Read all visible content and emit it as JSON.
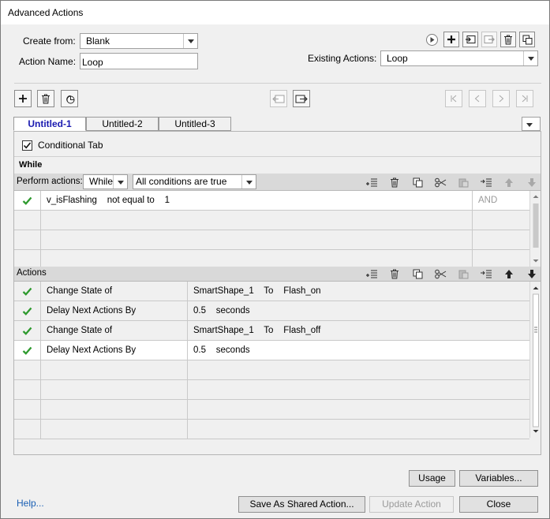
{
  "window": {
    "title": "Advanced Actions"
  },
  "form": {
    "create_from_label": "Create from:",
    "create_from_value": "Blank",
    "action_name_label": "Action Name:",
    "action_name_value": "Loop",
    "existing_actions_label": "Existing Actions:",
    "existing_actions_value": "Loop"
  },
  "tabs": [
    {
      "label": "Untitled-1",
      "active": true
    },
    {
      "label": "Untitled-2",
      "active": false
    },
    {
      "label": "Untitled-3",
      "active": false
    }
  ],
  "conditional": {
    "label": "Conditional Tab",
    "checked": true
  },
  "section_while": "While",
  "perform": {
    "label": "Perform actions:",
    "mode_value": "While",
    "conditions_value": "All conditions are true"
  },
  "conditions": [
    {
      "variable": "v_isFlashing",
      "operator": "not equal to",
      "value": "1",
      "logic": "AND"
    }
  ],
  "actions_label": "Actions",
  "actions": [
    {
      "action": "Change State of",
      "target": "SmartShape_1",
      "mid": "To",
      "param": "Flash_on"
    },
    {
      "action": "Delay Next Actions By",
      "target": "0.5",
      "mid": "seconds",
      "param": ""
    },
    {
      "action": "Change State of",
      "target": "SmartShape_1",
      "mid": "To",
      "param": "Flash_off"
    },
    {
      "action": "Delay Next Actions By",
      "target": "0.5",
      "mid": "seconds",
      "param": ""
    }
  ],
  "buttons": {
    "usage": "Usage",
    "variables": "Variables...",
    "help": "Help...",
    "save_shared": "Save As Shared Action...",
    "update": "Update Action",
    "close": "Close"
  },
  "colors": {
    "check_green": "#2e9a2e",
    "active_tab_text": "#1a1ab0",
    "link_blue": "#1a5fb4"
  }
}
